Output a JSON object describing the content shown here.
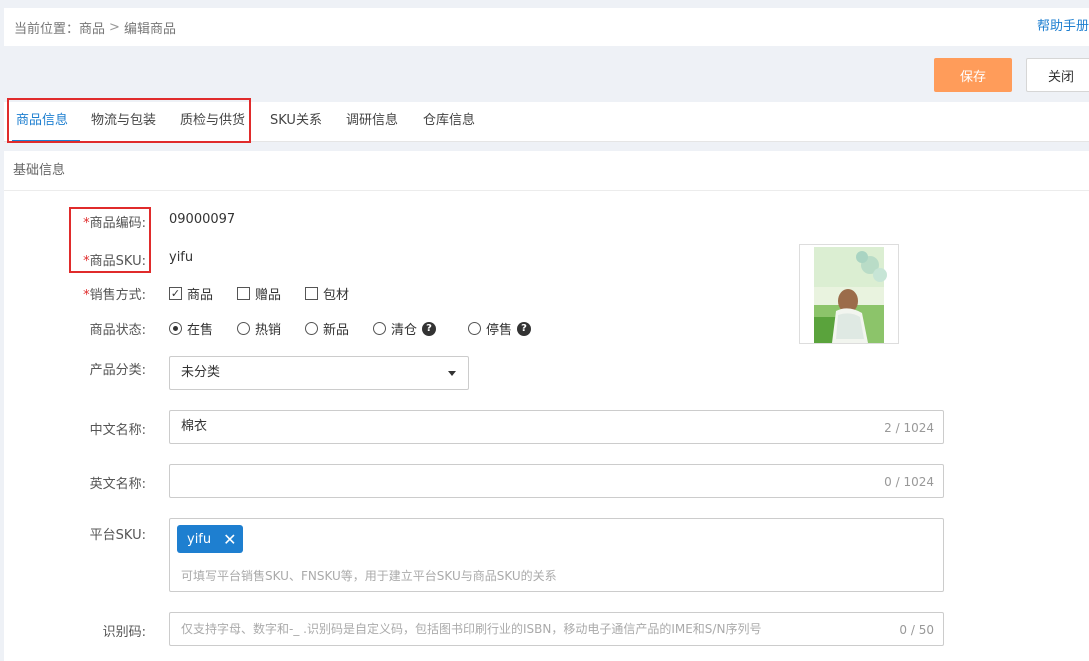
{
  "breadcrumb": {
    "prefix": "当前位置：",
    "items": [
      "商品",
      "编辑商品"
    ],
    "separator": ">"
  },
  "help_link": "帮助手册",
  "toolbar": {
    "save_label": "保存",
    "close_label": "关闭"
  },
  "tabs": [
    {
      "label": "商品信息",
      "active": true
    },
    {
      "label": "物流与包装"
    },
    {
      "label": "质检与供货"
    },
    {
      "label": "SKU关系"
    },
    {
      "label": "调研信息"
    },
    {
      "label": "仓库信息"
    }
  ],
  "section_title": "基础信息",
  "fields": {
    "code": {
      "label": "商品编码:",
      "required_mark": "*",
      "value": "09000097"
    },
    "sku": {
      "label": "商品SKU:",
      "required_mark": "*",
      "value": "yifu"
    },
    "sale_mode": {
      "label": "销售方式:",
      "required_mark": "*",
      "options": [
        {
          "label": "商品",
          "checked": true
        },
        {
          "label": "赠品",
          "checked": false
        },
        {
          "label": "包材",
          "checked": false
        }
      ]
    },
    "status": {
      "label": "商品状态:",
      "options": [
        {
          "label": "在售",
          "selected": true
        },
        {
          "label": "热销"
        },
        {
          "label": "新品"
        },
        {
          "label": "清仓",
          "help": "?"
        },
        {
          "label": "停售",
          "help": "?"
        }
      ]
    },
    "category": {
      "label": "产品分类:",
      "value": "未分类"
    },
    "cn_name": {
      "label": "中文名称:",
      "value": "棉衣",
      "counter": "2 / 1024"
    },
    "en_name": {
      "label": "英文名称:",
      "value": "",
      "counter": "0 / 1024"
    },
    "platform_sku": {
      "label": "平台SKU:",
      "tag": "yifu",
      "placeholder": "可填写平台销售SKU、FNSKU等，用于建立平台SKU与商品SKU的关系"
    },
    "ident_code": {
      "label": "识别码:",
      "placeholder": "仅支持字母、数字和-_ .识别码是自定义码，包括图书印刷行业的ISBN，移动电子通信产品的IME和S/N序列号",
      "counter": "0 / 50"
    }
  },
  "colors": {
    "accent": "#1e7fd0",
    "save_button": "#ff9c5a",
    "highlight_box": "#e02b2b"
  }
}
